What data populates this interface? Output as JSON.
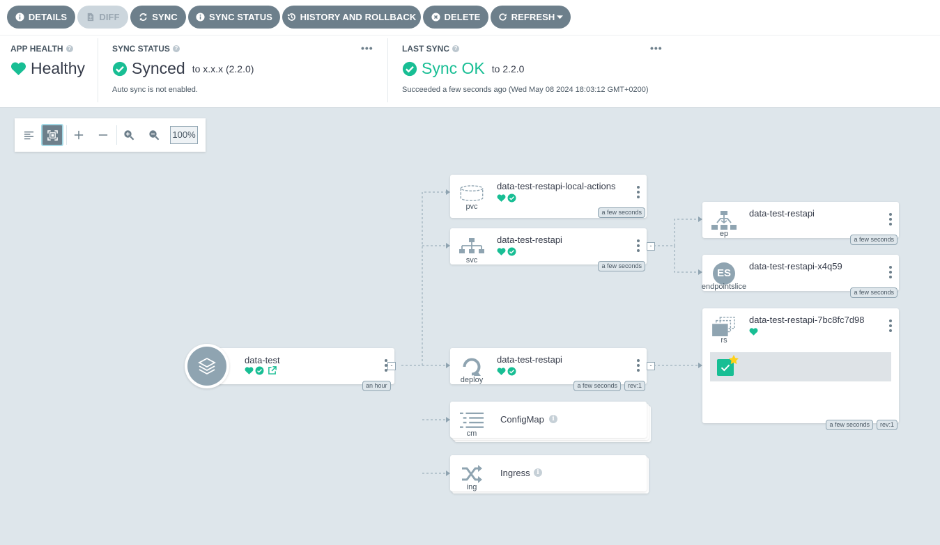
{
  "toolbar": {
    "details": "DETAILS",
    "diff": "DIFF",
    "sync": "SYNC",
    "sync_status": "SYNC STATUS",
    "history": "HISTORY AND ROLLBACK",
    "delete": "DELETE",
    "refresh": "REFRESH"
  },
  "status": {
    "app_health": {
      "title": "APP HEALTH",
      "value": "Healthy",
      "color": "#18be94"
    },
    "sync_status": {
      "title": "SYNC STATUS",
      "value": "Synced",
      "to": "to x.x.x (2.2.0)",
      "note": "Auto sync is not enabled.",
      "more": "•••"
    },
    "last_sync": {
      "title": "LAST SYNC",
      "value": "Sync OK",
      "to": "to 2.2.0",
      "note": "Succeeded a few seconds ago (Wed May 08 2024 18:03:12 GMT+0200)",
      "more": "•••"
    }
  },
  "graph_controls": {
    "zoom": "100%"
  },
  "nodes": {
    "root": {
      "name": "data-test",
      "age": "an hour"
    },
    "pvc": {
      "name": "data-test-restapi-local-actions",
      "kind": "pvc",
      "age": "a few seconds"
    },
    "svc": {
      "name": "data-test-restapi",
      "kind": "svc",
      "age": "a few seconds"
    },
    "deploy": {
      "name": "data-test-restapi",
      "kind": "deploy",
      "age": "a few seconds",
      "rev": "rev:1"
    },
    "cm": {
      "name": "ConfigMap",
      "kind": "cm"
    },
    "ing": {
      "name": "Ingress",
      "kind": "ing"
    },
    "ep": {
      "name": "data-test-restapi",
      "kind": "ep",
      "age": "a few seconds"
    },
    "es": {
      "name": "data-test-restapi-x4q59",
      "kind": "endpointslice",
      "abbr": "ES",
      "age": "a few seconds"
    },
    "rs": {
      "name": "data-test-restapi-7bc8fc7d98",
      "kind": "rs",
      "age": "a few seconds",
      "rev": "rev:1"
    }
  },
  "colors": {
    "healthy": "#18be94",
    "accent": "#6d7f8b",
    "background": "#dee6eb"
  }
}
